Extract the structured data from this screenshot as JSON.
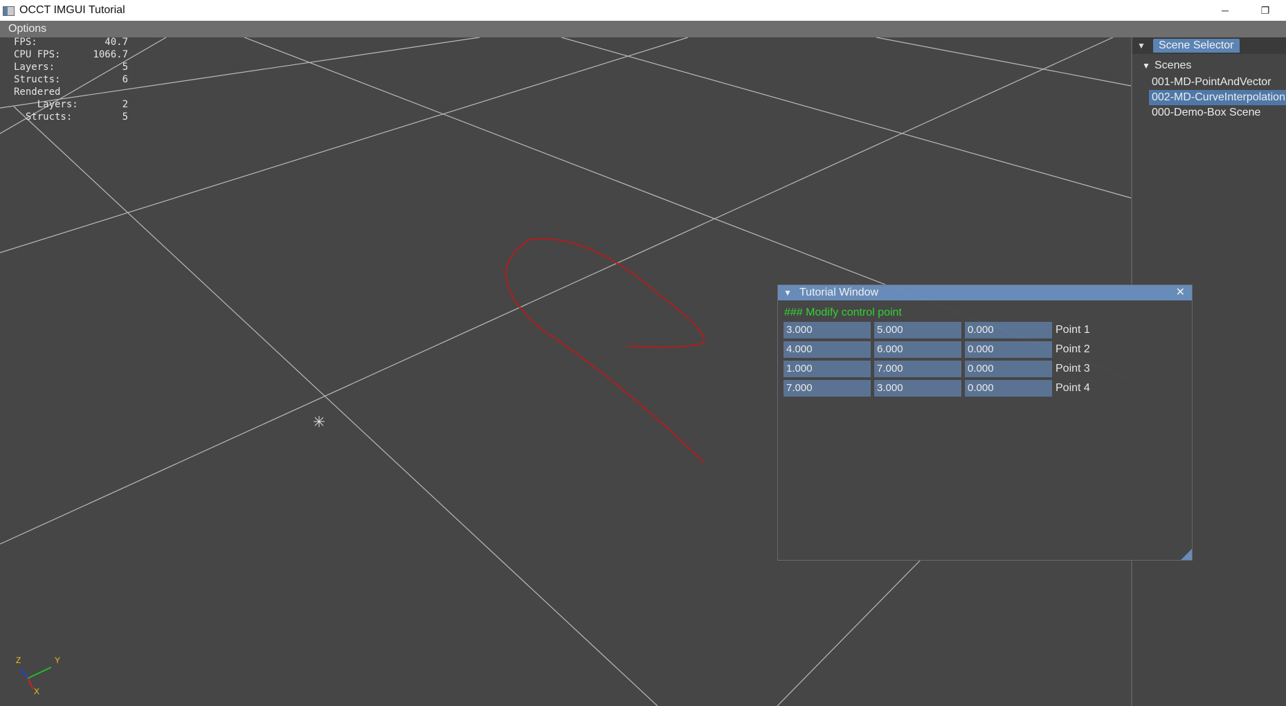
{
  "window": {
    "title": "OCCT IMGUI Tutorial",
    "minimize_glyph": "─",
    "restore_glyph": "❐"
  },
  "menu": {
    "options_label": "Options"
  },
  "stats": [
    {
      "label": "FPS:",
      "value": "40.7"
    },
    {
      "label": "CPU FPS:",
      "value": "1066.7"
    },
    {
      "label": "Layers:",
      "value": "5"
    },
    {
      "label": "Structs:",
      "value": "6"
    },
    {
      "label": "Rendered",
      "value": ""
    },
    {
      "label": "    Layers:",
      "value": "2"
    },
    {
      "label": "  Structs:",
      "value": "5"
    }
  ],
  "axis_triad": {
    "z_label": "Z",
    "y_label": "Y",
    "x_label": "X",
    "colors": {
      "x": "#d02020",
      "y": "#20c020",
      "z": "#2040e0"
    }
  },
  "scene_selector": {
    "tab_label": "Scene Selector",
    "root_label": "Scenes",
    "items": [
      {
        "label": "001-MD-PointAndVector",
        "selected": false
      },
      {
        "label": "002-MD-CurveInterpolation",
        "selected": true
      },
      {
        "label": "000-Demo-Box Scene",
        "selected": false
      }
    ]
  },
  "tutorial_window": {
    "title": "Tutorial Window",
    "close_glyph": "✕",
    "heading": "### Modify control point",
    "points": [
      {
        "x": "3.000",
        "y": "5.000",
        "z": "0.000",
        "label": "Point 1"
      },
      {
        "x": "4.000",
        "y": "6.000",
        "z": "0.000",
        "label": "Point 2"
      },
      {
        "x": "1.000",
        "y": "7.000",
        "z": "0.000",
        "label": "Point 3"
      },
      {
        "x": "7.000",
        "y": "3.000",
        "z": "0.000",
        "label": "Point 4"
      }
    ]
  },
  "colors": {
    "background": "#464646",
    "grid": "#cfcfcf",
    "curve": "#b01e1e",
    "accent": "#5b84b4",
    "heading": "#33d633"
  }
}
